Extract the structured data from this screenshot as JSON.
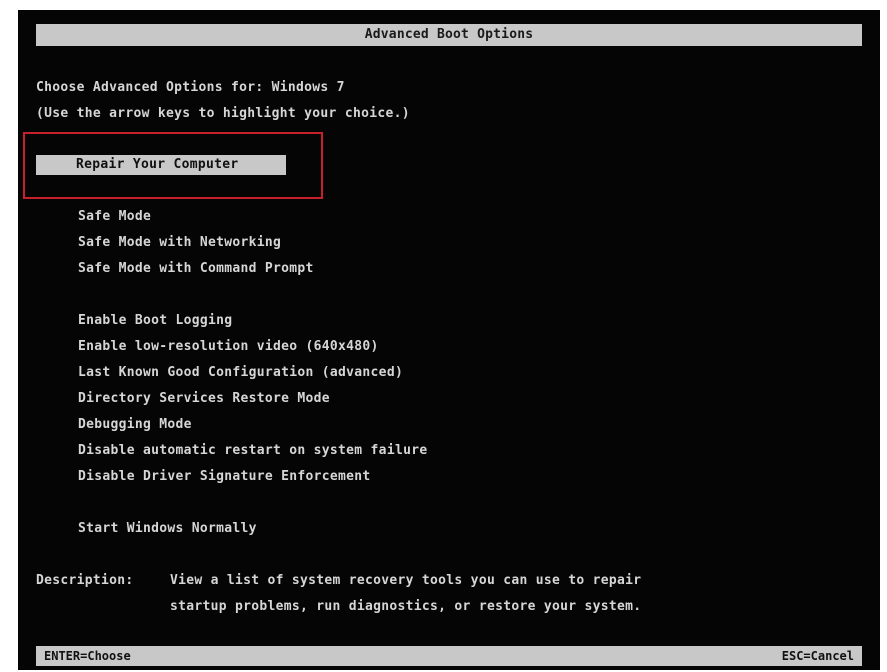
{
  "title": "Advanced Boot Options",
  "header": {
    "line1": "Choose Advanced Options for: Windows 7",
    "line2": "(Use the arrow keys to highlight your choice.)"
  },
  "selected": "Repair Your Computer",
  "menu": {
    "group1": [
      "Safe Mode",
      "Safe Mode with Networking",
      "Safe Mode with Command Prompt"
    ],
    "group2": [
      "Enable Boot Logging",
      "Enable low-resolution video (640x480)",
      "Last Known Good Configuration (advanced)",
      "Directory Services Restore Mode",
      "Debugging Mode",
      "Disable automatic restart on system failure",
      "Disable Driver Signature Enforcement"
    ],
    "group3": [
      "Start Windows Normally"
    ]
  },
  "description": {
    "label": "Description:",
    "line1": "View a list of system recovery tools you can use to repair",
    "line2": "startup problems, run diagnostics, or restore your system."
  },
  "footer": {
    "left": "ENTER=Choose",
    "right": "ESC=Cancel"
  },
  "colors": {
    "background": "#050505",
    "text": "#d6d6d6",
    "bar": "#c8c8c8",
    "highlight_border": "#c8202a"
  }
}
